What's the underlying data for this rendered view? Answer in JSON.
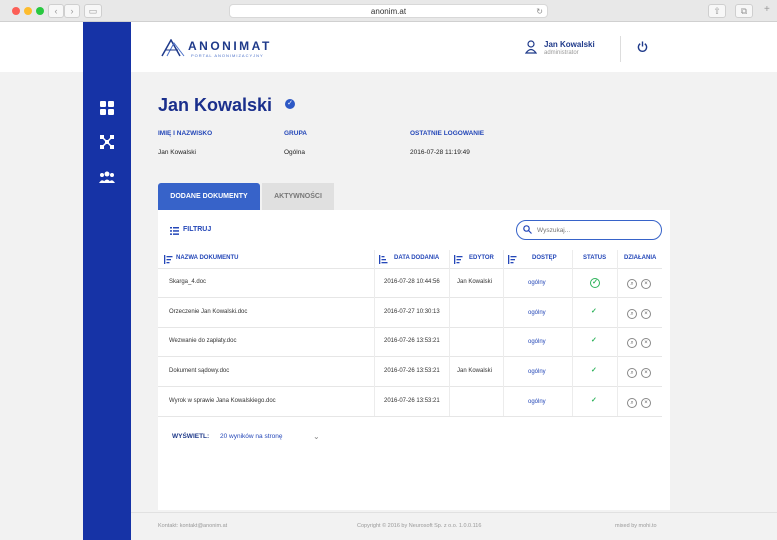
{
  "browser": {
    "url": "anonim.at"
  },
  "logo": {
    "name": "ANONIMAT",
    "tagline": "PORTAL ANONIMIZACYJNY"
  },
  "user": {
    "name": "Jan Kowalski",
    "role": "administrator"
  },
  "profile": {
    "title": "Jan Kowalski",
    "fields": [
      {
        "label": "IMIĘ I NAZWISKO",
        "value": "Jan Kowalski"
      },
      {
        "label": "GRUPA",
        "value": "Ogólna"
      },
      {
        "label": "OSTATNIE LOGOWANIE",
        "value": "2016-07-28 11:19:49"
      }
    ]
  },
  "tabs": {
    "active": "DODANE DOKUMENTY",
    "inactive": "AKTYWNOŚCI"
  },
  "toolbar": {
    "filter": "FILTRUJ",
    "search_placeholder": "Wyszukaj..."
  },
  "table": {
    "headers": [
      "NAZWA DOKUMENTU",
      "DATA DODANIA",
      "EDYTOR",
      "DOSTĘP",
      "STATUS",
      "DZIAŁANIA"
    ],
    "rows": [
      {
        "name": "Skarga_4.doc",
        "date": "2016-07-28 10:44:56",
        "editor": "Jan Kowalski",
        "access": "ogólny"
      },
      {
        "name": "Orzeczenie Jan Kowalski.doc",
        "date": "2016-07-27 10:30:13",
        "editor": "",
        "access": "ogólny"
      },
      {
        "name": "Wezwanie do zapłaty.doc",
        "date": "2016-07-26 13:53:21",
        "editor": "",
        "access": "ogólny"
      },
      {
        "name": "Dokument sądowy.doc",
        "date": "2016-07-26 13:53:21",
        "editor": "Jan Kowalski",
        "access": "ogólny"
      },
      {
        "name": "Wyrok w sprawie Jana Kowalskiego.doc",
        "date": "2016-07-26 13:53:21",
        "editor": "",
        "access": "ogólny"
      }
    ]
  },
  "pagination": {
    "label": "WYŚWIETL:",
    "value": "20 wyników na stronę"
  },
  "footer": {
    "contact": "Kontakt: kontakt@anonim.at",
    "copyright": "Copyright © 2016 by Neurosoft Sp. z o.o. 1.0.0.116",
    "credit": "mixed by mohi.to"
  },
  "colors": {
    "sidebar": "#1633a6",
    "accent": "#3763c9",
    "status_ok": "#2eb35b"
  }
}
